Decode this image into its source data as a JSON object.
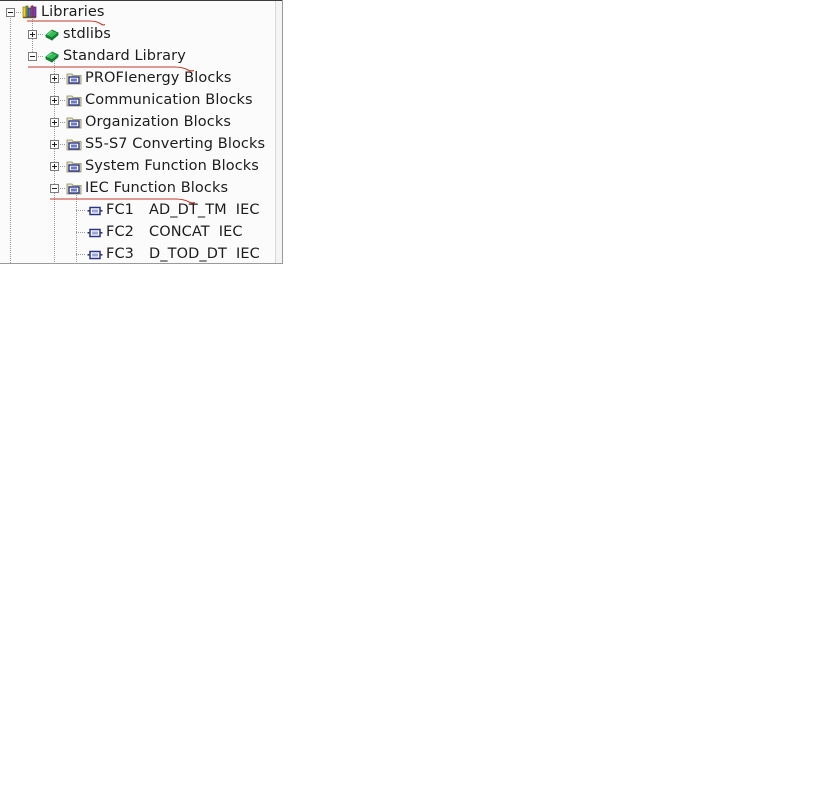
{
  "panel": {
    "name": "library-tree-panel",
    "background_color": "#fbfbfb",
    "border_color": "#9a9a9a"
  },
  "tree": {
    "root": {
      "label": "Libraries",
      "icon": "books-stack-icon",
      "expander": "minus",
      "misspelled": true
    },
    "level1": [
      {
        "label": "stdlibs",
        "icon": "green-book-icon",
        "expander": "plus",
        "misspelled": false
      },
      {
        "label": "Standard Library",
        "icon": "green-book-icon",
        "expander": "minus",
        "misspelled": true
      }
    ],
    "level2": [
      {
        "label": "PROFIenergy Blocks",
        "icon": "block-folder-icon",
        "expander": "plus",
        "misspelled": false
      },
      {
        "label": "Communication Blocks",
        "icon": "block-folder-icon",
        "expander": "plus",
        "misspelled": false
      },
      {
        "label": "Organization Blocks",
        "icon": "block-folder-icon",
        "expander": "plus",
        "misspelled": false
      },
      {
        "label": "S5-S7 Converting Blocks",
        "icon": "block-folder-icon",
        "expander": "plus",
        "misspelled": false
      },
      {
        "label": "System Function Blocks",
        "icon": "block-folder-icon",
        "expander": "plus",
        "misspelled": false
      },
      {
        "label": "IEC Function Blocks",
        "icon": "block-folder-icon",
        "expander": "minus",
        "misspelled": true
      }
    ],
    "level3": [
      {
        "fc": "FC1",
        "name": "AD_DT_TM",
        "library": "IEC",
        "icon": "function-block-icon"
      },
      {
        "fc": "FC2",
        "name": "CONCAT",
        "library": "IEC",
        "icon": "function-block-icon"
      },
      {
        "fc": "FC3",
        "name": "D_TOD_DT",
        "library": "IEC",
        "icon": "function-block-icon"
      }
    ]
  },
  "colors": {
    "text": "#1d1d1d",
    "spellcheck_underline": "#c0392b",
    "guide_line": "#9a9a9a",
    "green_book": "#22b14c",
    "block_blue": "#34409a"
  }
}
